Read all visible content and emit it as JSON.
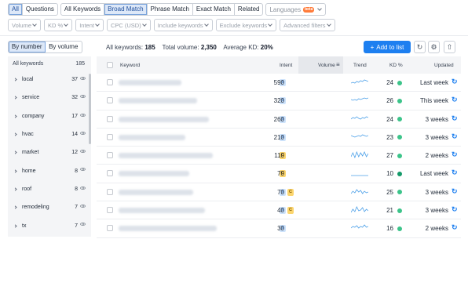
{
  "top_tabs": {
    "group1": [
      {
        "label": "All",
        "active": true
      },
      {
        "label": "Questions",
        "active": false
      }
    ],
    "group2": [
      {
        "label": "All Keywords",
        "active": false
      },
      {
        "label": "Broad Match",
        "active": true
      },
      {
        "label": "Phrase Match",
        "active": false
      },
      {
        "label": "Exact Match",
        "active": false
      },
      {
        "label": "Related",
        "active": false
      }
    ],
    "languages": {
      "label": "Languages",
      "badge": "beta"
    }
  },
  "filters": [
    "Volume",
    "KD %",
    "Intent",
    "CPC (USD)",
    "Include keywords",
    "Exclude keywords",
    "Advanced filters"
  ],
  "sidebar": {
    "toggle": [
      {
        "label": "By number",
        "active": true
      },
      {
        "label": "By volume",
        "active": false
      }
    ],
    "header": {
      "label": "All keywords",
      "count": "185"
    },
    "items": [
      {
        "label": "local",
        "count": "37"
      },
      {
        "label": "service",
        "count": "32"
      },
      {
        "label": "company",
        "count": "17"
      },
      {
        "label": "hvac",
        "count": "14"
      },
      {
        "label": "market",
        "count": "12"
      },
      {
        "label": "home",
        "count": "8"
      },
      {
        "label": "roof",
        "count": "8"
      },
      {
        "label": "remodeling",
        "count": "7"
      },
      {
        "label": "tx",
        "count": "7"
      }
    ]
  },
  "summary": {
    "all_label": "All keywords:",
    "all_value": "185",
    "vol_label": "Total volume:",
    "vol_value": "2,350",
    "kd_label": "Average KD:",
    "kd_value": "20%"
  },
  "actions": {
    "add_label": "Add to list"
  },
  "table": {
    "headers": {
      "keyword": "Keyword",
      "intent": "Intent",
      "volume": "Volume",
      "trend": "Trend",
      "kd": "KD %",
      "updated": "Updated"
    },
    "rows": [
      {
        "intent": [
          "I"
        ],
        "volume": "590",
        "kd": "24",
        "kd_color": "#3cc48a",
        "updated": "Last week",
        "trend": [
          4,
          5,
          4,
          6,
          5,
          7,
          6,
          8,
          7,
          6
        ]
      },
      {
        "intent": [
          "I"
        ],
        "volume": "320",
        "kd": "26",
        "kd_color": "#3cc48a",
        "updated": "This week",
        "trend": [
          6,
          5,
          6,
          5,
          7,
          6,
          7,
          8,
          7,
          8
        ]
      },
      {
        "intent": [
          "I"
        ],
        "volume": "260",
        "kd": "24",
        "kd_color": "#3cc48a",
        "updated": "3 weeks",
        "trend": [
          5,
          7,
          6,
          8,
          6,
          5,
          7,
          6,
          8,
          7
        ]
      },
      {
        "intent": [
          "I"
        ],
        "volume": "210",
        "kd": "23",
        "kd_color": "#3cc48a",
        "updated": "3 weeks",
        "trend": [
          7,
          6,
          5,
          6,
          7,
          6,
          8,
          7,
          6,
          7
        ]
      },
      {
        "intent": [
          "C"
        ],
        "volume": "110",
        "kd": "27",
        "kd_color": "#3cc48a",
        "updated": "2 weeks",
        "trend": [
          3,
          8,
          2,
          9,
          3,
          8,
          4,
          9,
          3,
          7
        ]
      },
      {
        "intent": [
          "C"
        ],
        "volume": "70",
        "kd": "10",
        "kd_color": "#159a6a",
        "updated": "Last week",
        "trend": [
          2,
          2,
          2,
          2,
          2,
          2,
          2,
          2,
          2,
          2
        ]
      },
      {
        "intent": [
          "I",
          "C"
        ],
        "volume": "70",
        "kd": "25",
        "kd_color": "#3cc48a",
        "updated": "3 weeks",
        "trend": [
          3,
          6,
          4,
          8,
          5,
          7,
          3,
          6,
          4,
          5
        ]
      },
      {
        "intent": [
          "I",
          "C"
        ],
        "volume": "40",
        "kd": "21",
        "kd_color": "#3cc48a",
        "updated": "3 weeks",
        "trend": [
          2,
          6,
          3,
          9,
          4,
          5,
          8,
          3,
          6,
          4
        ]
      },
      {
        "intent": [
          "I"
        ],
        "volume": "30",
        "kd": "16",
        "kd_color": "#3cc48a",
        "updated": "2 weeks",
        "trend": [
          5,
          7,
          6,
          8,
          5,
          7,
          6,
          9,
          6,
          7
        ]
      }
    ]
  }
}
